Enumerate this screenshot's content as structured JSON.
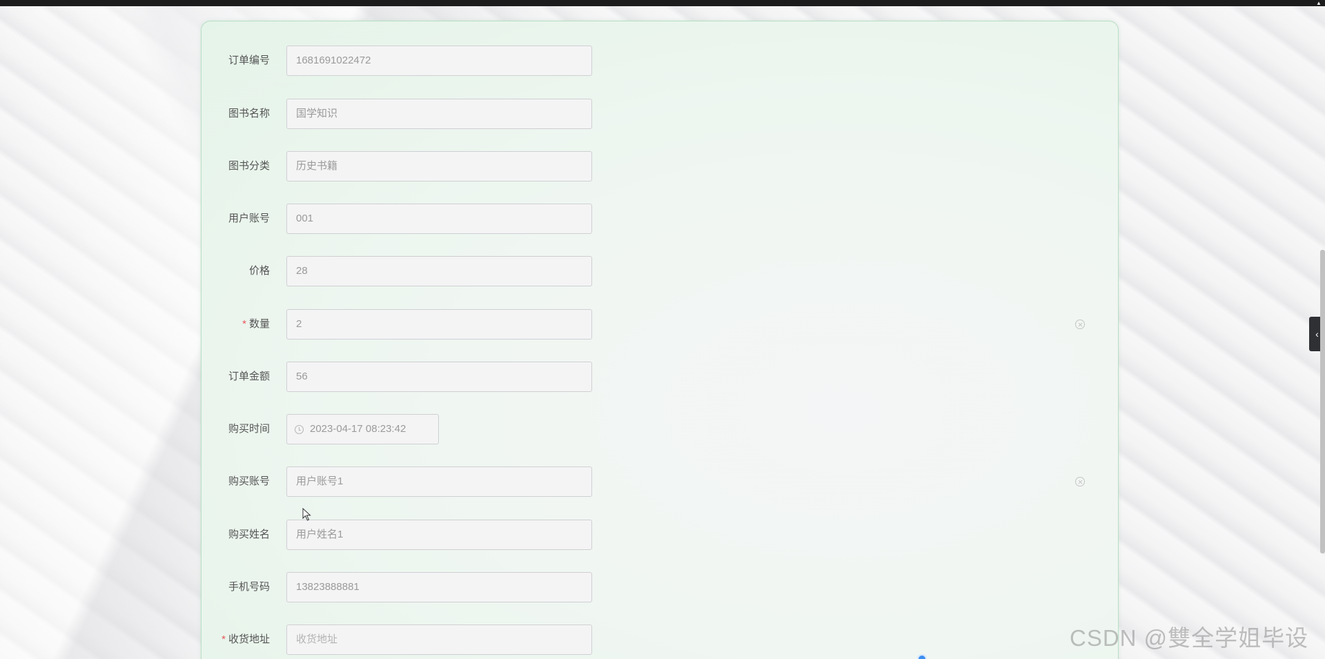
{
  "form": {
    "fields": [
      {
        "label": "订单编号",
        "value": "1681691022472",
        "required": false
      },
      {
        "label": "图书名称",
        "value": "国学知识",
        "required": false
      },
      {
        "label": "图书分类",
        "value": "历史书籍",
        "required": false
      },
      {
        "label": "用户账号",
        "value": "001",
        "required": false
      },
      {
        "label": "价格",
        "value": "28",
        "required": false
      },
      {
        "label": "数量",
        "value": "2",
        "required": true
      },
      {
        "label": "订单金额",
        "value": "56",
        "required": false
      },
      {
        "label": "购买时间",
        "value": "2023-04-17 08:23:42",
        "required": false
      },
      {
        "label": "购买账号",
        "value": "用户账号1",
        "required": false
      },
      {
        "label": "购买姓名",
        "value": "用户姓名1",
        "required": false
      },
      {
        "label": "手机号码",
        "value": "13823888881",
        "required": false
      },
      {
        "label": "收货地址",
        "placeholder": "收货地址",
        "required": true
      }
    ],
    "required_mark": "*"
  },
  "icons": {
    "clock": "clock-icon",
    "clear": "circle-close-icon",
    "side_toggle": "chevron-left-icon"
  },
  "side_toggle_glyph": "‹",
  "watermark": "CSDN @雙全学姐毕设",
  "colors": {
    "card_border": "#b9dec4",
    "required": "#e8575b",
    "top_bar": "#1c1c1c"
  }
}
